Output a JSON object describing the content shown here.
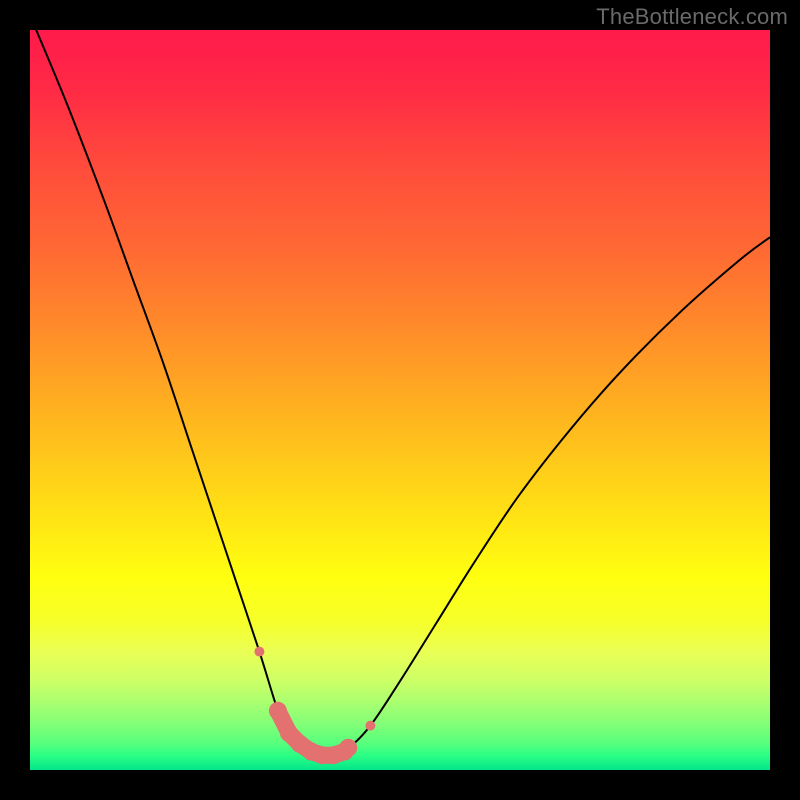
{
  "watermark": {
    "text": "TheBottleneck.com"
  },
  "colors": {
    "frame": "#000000",
    "curve_stroke": "#000000",
    "marker_fill": "#e27170",
    "marker_stroke": "#b35655"
  },
  "chart_data": {
    "type": "line",
    "title": "",
    "xlabel": "",
    "ylabel": "",
    "xlim": [
      0,
      100
    ],
    "ylim": [
      0,
      100
    ],
    "grid": false,
    "legend": false,
    "annotations": [],
    "series": [
      {
        "name": "bottleneck-curve",
        "x": [
          0,
          5,
          10,
          14,
          18,
          22,
          25,
          28,
          31,
          33.5,
          34,
          36,
          38,
          40,
          43,
          46,
          50,
          55,
          60,
          66,
          73,
          80,
          88,
          96,
          100
        ],
        "values": [
          102,
          90,
          77,
          66,
          55,
          43,
          34,
          25,
          16,
          8,
          8,
          4,
          2,
          2,
          3,
          6,
          12,
          20,
          28,
          37,
          46,
          54,
          62,
          69,
          72
        ]
      }
    ],
    "markers": {
      "name": "optimum-band",
      "x": [
        31,
        33.2,
        33.5,
        35,
        36.5,
        38,
        39.5,
        41,
        42.5,
        43,
        46
      ],
      "values": [
        16,
        8,
        8,
        5,
        3.5,
        2.5,
        2,
        2,
        2.5,
        3,
        6
      ],
      "sizes": [
        5,
        5,
        9,
        9,
        9,
        9,
        9,
        9,
        9,
        9,
        5
      ]
    }
  }
}
